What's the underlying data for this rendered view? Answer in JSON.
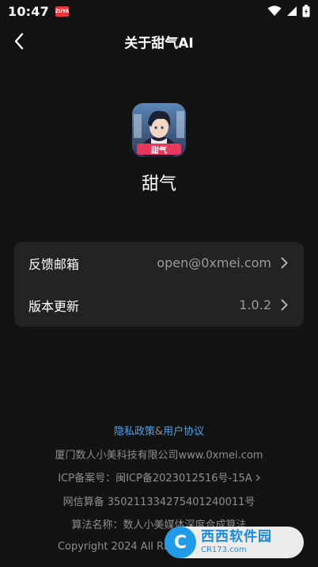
{
  "status_bar": {
    "time": "10:47",
    "app_icon_text": "ZUYA",
    "icons": [
      "wifi-icon",
      "signal-icon",
      "battery-icon"
    ]
  },
  "header": {
    "title": "关于甜气AI",
    "back_icon": "chevron-left-icon"
  },
  "app": {
    "logo_badge": "甜气",
    "name": "甜气"
  },
  "settings": {
    "rows": [
      {
        "label": "反馈邮箱",
        "value": "open@0xmei.com"
      },
      {
        "label": "版本更新",
        "value": "1.0.2"
      }
    ]
  },
  "footer": {
    "privacy_link": "隐私政策",
    "separator": "&",
    "user_agreement_link": "用户协议",
    "company": "厦门数人小美科技有限公司www.0xmei.com",
    "icp": "ICP备案号：闽ICP备2023012516号-15A",
    "net_filing": "网信算备 350211334275401240011号",
    "algorithm": "算法名称：数人小美媒体深度合成算法",
    "copyright": "Copyright 2024 All Rights"
  },
  "watermark": {
    "logo_letter": "C",
    "title": "西西软件园",
    "subtitle": "CR173.com"
  },
  "colors": {
    "background": "#131313",
    "card": "#232323",
    "link": "#4ea2e6",
    "muted": "#8e8e8e"
  }
}
